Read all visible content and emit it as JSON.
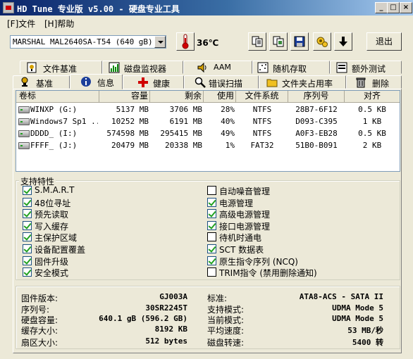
{
  "window": {
    "title": "HD Tune 专业版 v5.00 - 硬盘专业工具",
    "controls": {
      "minimize": "_",
      "maximize": "□",
      "close": "×"
    }
  },
  "menu": {
    "items": [
      "[F]文件",
      "[H]帮助"
    ]
  },
  "toolbar": {
    "drive": "MARSHAL MAL2640SA-T54 (640 gB)",
    "temperature": "36℃",
    "exit_label": "退出",
    "buttons": [
      "copy-text-icon",
      "copy-screenshot-icon",
      "save-icon",
      "options-icon",
      "down-arrow-icon"
    ]
  },
  "tabs": {
    "row1": [
      {
        "label": "文件基准",
        "icon": "file-benchmark-icon"
      },
      {
        "label": "磁盘监视器",
        "icon": "disk-monitor-icon"
      },
      {
        "label": "AAM",
        "icon": "speaker-icon"
      },
      {
        "label": "随机存取",
        "icon": "random-access-icon"
      },
      {
        "label": "额外测试",
        "icon": "extra-tests-icon"
      }
    ],
    "row2": [
      {
        "label": "基准",
        "icon": "benchmark-icon"
      },
      {
        "label": "信息",
        "icon": "info-icon",
        "active": true
      },
      {
        "label": "健康",
        "icon": "health-icon"
      },
      {
        "label": "错误扫描",
        "icon": "error-scan-icon"
      },
      {
        "label": "文件夹占用率",
        "icon": "folder-usage-icon"
      },
      {
        "label": "删除",
        "icon": "erase-icon"
      }
    ]
  },
  "volumes": {
    "headers": [
      "卷标",
      "容量",
      "剩余",
      "使用",
      "文件系统",
      "序列号",
      "对齐"
    ],
    "rows": [
      [
        "WINXP (G:)",
        "5137 MB",
        "3706 MB",
        "28%",
        "NTFS",
        "28B7-6F12",
        "0.5 KB"
      ],
      [
        "Windows7 Sp1 ...",
        "10252 MB",
        "6191 MB",
        "40%",
        "NTFS",
        "D093-C395",
        "1 KB"
      ],
      [
        "DDDD_ (I:)",
        "574598 MB",
        "295415 MB",
        "49%",
        "NTFS",
        "A0F3-EB28",
        "0.5 KB"
      ],
      [
        "FFFF_ (J:)",
        "20479 MB",
        "20338 MB",
        "1%",
        "FAT32",
        "51B0-B091",
        "2 KB"
      ]
    ]
  },
  "features": {
    "title": "支持特性",
    "left": [
      {
        "label": "S.M.A.R.T",
        "checked": true
      },
      {
        "label": "48位寻址",
        "checked": true
      },
      {
        "label": "预先读取",
        "checked": true
      },
      {
        "label": "写入缓存",
        "checked": true
      },
      {
        "label": "主保护区域",
        "checked": true
      },
      {
        "label": "设备配置覆盖",
        "checked": true
      },
      {
        "label": "固件升级",
        "checked": true
      },
      {
        "label": "安全模式",
        "checked": true
      }
    ],
    "right": [
      {
        "label": "自动噪音管理",
        "checked": false
      },
      {
        "label": "电源管理",
        "checked": true
      },
      {
        "label": "高级电源管理",
        "checked": true
      },
      {
        "label": "接口电源管理",
        "checked": true
      },
      {
        "label": "待机时通电",
        "checked": false
      },
      {
        "label": "SCT 数据表",
        "checked": true
      },
      {
        "label": "原生指令序列 (NCQ)",
        "checked": true
      },
      {
        "label": "TRIM指令 (禁用删除通知)",
        "checked": false
      }
    ]
  },
  "info": {
    "left": [
      {
        "label": "固件版本:",
        "value": "GJ003A"
      },
      {
        "label": "序列号:",
        "value": "30SR2245T"
      },
      {
        "label": "硬盘容量:",
        "value": "640.1 gB (596.2 GB)"
      },
      {
        "label": "缓存大小:",
        "value": "8192 KB"
      },
      {
        "label": "扇区大小:",
        "value": "512 bytes"
      }
    ],
    "right": [
      {
        "label": "标准:",
        "value": "ATA8-ACS - SATA II"
      },
      {
        "label": "支持模式:",
        "value": "UDMA Mode 5"
      },
      {
        "label": "当前模式:",
        "value": "UDMA Mode 5"
      },
      {
        "label": "平均速度:",
        "value": "53 MB/秒"
      },
      {
        "label": "磁盘转速:",
        "value": "5400 转"
      }
    ]
  }
}
